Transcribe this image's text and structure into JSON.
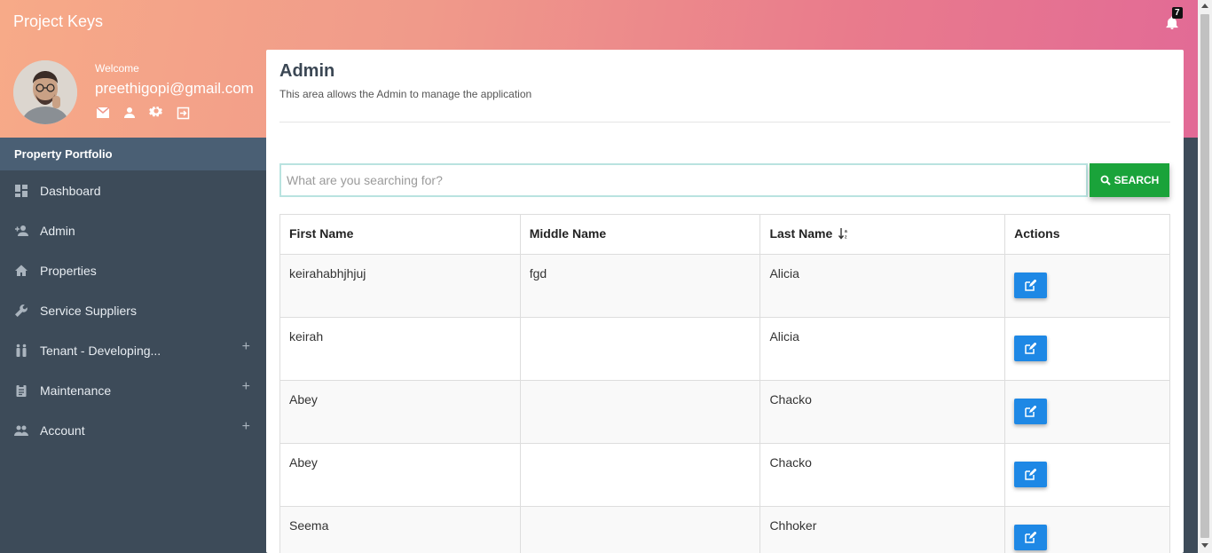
{
  "app": {
    "title": "Project Keys",
    "notification_count": "7"
  },
  "user": {
    "welcome": "Welcome",
    "email": "preethigopi@gmail.com"
  },
  "sidebar": {
    "header": "Property Portfolio",
    "items": [
      {
        "label": "Dashboard",
        "icon": "dashboard-icon",
        "expandable": false
      },
      {
        "label": "Admin",
        "icon": "add-user-icon",
        "expandable": false
      },
      {
        "label": "Properties",
        "icon": "home-icon",
        "expandable": false
      },
      {
        "label": "Service Suppliers",
        "icon": "wrench-icon",
        "expandable": false
      },
      {
        "label": "Tenant - Developing...",
        "icon": "people-icon",
        "expandable": true
      },
      {
        "label": "Maintenance",
        "icon": "clipboard-icon",
        "expandable": true
      },
      {
        "label": "Account",
        "icon": "group-icon",
        "expandable": true
      }
    ],
    "plus_glyph": "+"
  },
  "page": {
    "title": "Admin",
    "subtitle": "This area allows the Admin to manage the application"
  },
  "search": {
    "placeholder": "What are you searching for?",
    "button_label": "SEARCH"
  },
  "table": {
    "columns": [
      "First Name",
      "Middle Name",
      "Last Name",
      "Actions"
    ],
    "rows": [
      {
        "first": "keirahabhjhjuj",
        "middle": "fgd",
        "last": "Alicia"
      },
      {
        "first": "keirah",
        "middle": "",
        "last": "Alicia"
      },
      {
        "first": "Abey",
        "middle": "",
        "last": "Chacko"
      },
      {
        "first": "Abey",
        "middle": "",
        "last": "Chacko"
      },
      {
        "first": "Seema",
        "middle": "",
        "last": "Chhoker"
      }
    ]
  },
  "colors": {
    "accent": "#1e88e5",
    "search_button": "#1aa33a",
    "sidebar": "#3d4b59"
  }
}
